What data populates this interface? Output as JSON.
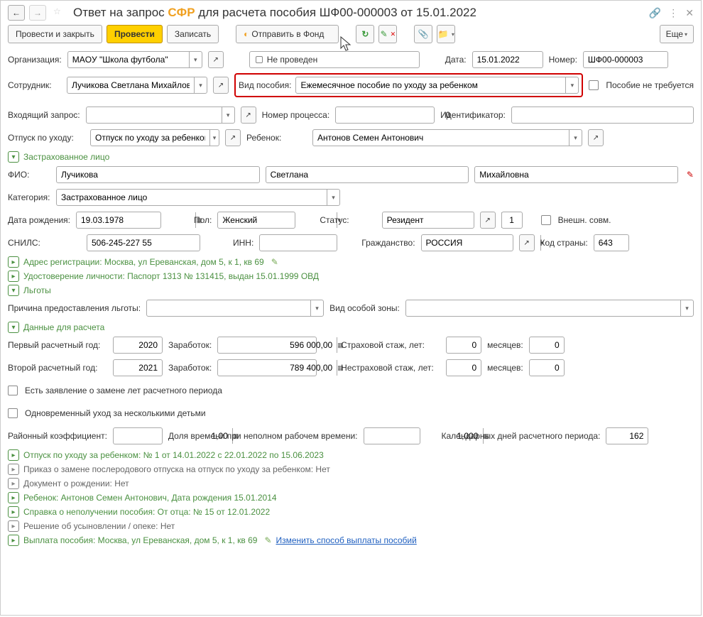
{
  "title": {
    "prefix": "Ответ на запрос ",
    "sfr": "СФР",
    "suffix": " для расчета пособия ШФ00-000003 от 15.01.2022"
  },
  "toolbar": {
    "post_close": "Провести и закрыть",
    "post": "Провести",
    "write": "Записать",
    "send": "Отправить в Фонд",
    "more": "Еще"
  },
  "header": {
    "org_label": "Организация:",
    "org_value": "МAOУ \"Школа футбола\"",
    "status": "Не проведен",
    "date_label": "Дата:",
    "date_value": "15.01.2022",
    "num_label": "Номер:",
    "num_value": "ШФ00-000003",
    "employee_label": "Сотрудник:",
    "employee_value": "Лучикова Светлана Михайловна",
    "benefit_type_label": "Вид пособия:",
    "benefit_type_value": "Ежемесячное пособие по уходу за ребенком",
    "no_benefit_label": "Пособие не требуется",
    "request_label": "Входящий запрос:",
    "process_label": "Номер процесса:",
    "process_value": "0",
    "id_label": "Идентификатор:",
    "leave_label": "Отпуск по уходу:",
    "leave_value": "Отпуск по уходу за ребенком",
    "child_label": "Ребенок:",
    "child_value": "Антонов Семен Антонович"
  },
  "insured": {
    "section": "Застрахованное лицо",
    "fio_label": "ФИО:",
    "last": "Лучикова",
    "first": "Светлана",
    "middle": "Михайловна",
    "category_label": "Категория:",
    "category_value": "Застрахованное лицо",
    "dob_label": "Дата рождения:",
    "dob_value": "19.03.1978",
    "sex_label": "Пол:",
    "sex_value": "Женский",
    "status_label": "Статус:",
    "status_value": "Резидент",
    "status_code": "1",
    "external_label": "Внешн. совм.",
    "snils_label": "СНИЛС:",
    "snils_value": "506-245-227 55",
    "inn_label": "ИНН:",
    "citizen_label": "Гражданство:",
    "citizen_value": "РОССИЯ",
    "country_label": "Код страны:",
    "country_value": "643",
    "addr_label": "Адрес регистрации: ",
    "addr_value": "Москва, ул Ереванская, дом 5, к 1, кв 69",
    "id_doc_label": "Удостоверение личности: ",
    "id_doc_value": "Паспорт 1313 № 131415, выдан 15.01.1999 ОВД"
  },
  "privileges": {
    "section": "Льготы",
    "reason_label": "Причина предоставления льготы:",
    "zone_label": "Вид особой зоны:"
  },
  "calc": {
    "section": "Данные для расчета",
    "year1_label": "Первый расчетный год:",
    "year1_value": "2020",
    "earn_label": "Заработок:",
    "earn1_value": "596 000,00",
    "year2_label": "Второй расчетный год:",
    "year2_value": "2021",
    "earn2_value": "789 400,00",
    "ins_stage_label": "Страховой стаж, лет:",
    "ins_stage_value": "0",
    "months_label": "месяцев:",
    "ins_months_value": "0",
    "nonins_stage_label": "Нестраховой стаж, лет:",
    "nonins_stage_value": "0",
    "nonins_months_value": "0",
    "replace_years_label": "Есть заявление о замене лет расчетного периода",
    "multiple_children_label": "Одновременный уход за несколькими детьми",
    "coef_label": "Районный коэффициент:",
    "coef_value": "1,00",
    "parttime_label": "Доля времени при неполном рабочем времени:",
    "parttime_value": "1,000",
    "period_days_label": "Календарных дней расчетного периода:",
    "period_days_value": "162"
  },
  "sections": {
    "leave": "Отпуск по уходу за ребенком: № 1 от 14.01.2022 с 22.01.2022 по 15.06.2023",
    "replace_order": "Приказ о замене послеродового отпуска на отпуск по уходу за ребенком: Нет",
    "birth_doc": "Документ о рождении: Нет",
    "child": "Ребенок: Антонов Семен Антонович, Дата рождения 15.01.2014",
    "cert": "Справка о неполучении пособия: От отца: № 15 от 12.01.2022",
    "adoption": "Решение об усыновлении / опеке: Нет",
    "payment_label": "Выплата пособия: ",
    "payment_addr": "Москва, ул Ереванская, дом 5, к 1, кв 69",
    "payment_link": "Изменить способ выплаты пособий"
  }
}
